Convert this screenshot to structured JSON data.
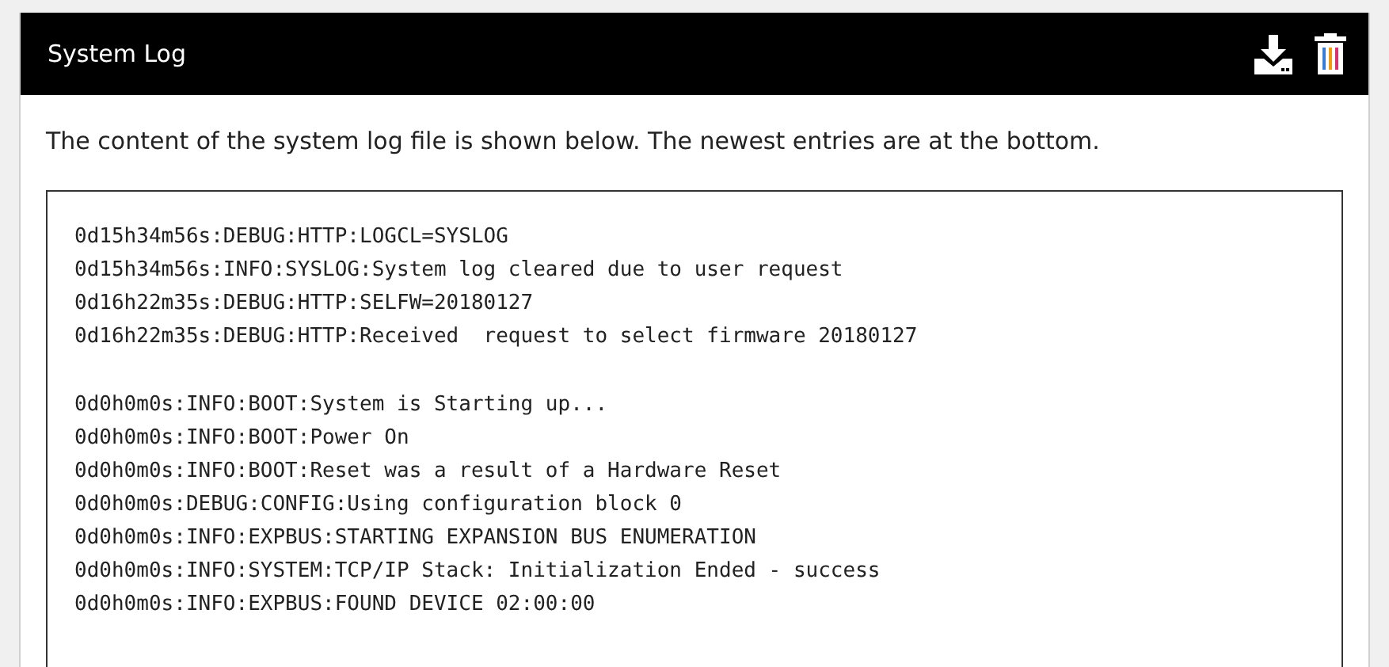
{
  "panel": {
    "title": "System Log"
  },
  "description": "The content of the system log file is shown below. The newest entries are at the bottom.",
  "log_blocks": [
    [
      "0d15h34m56s:DEBUG:HTTP:LOGCL=SYSLOG",
      "0d15h34m56s:INFO:SYSLOG:System log cleared due to user request",
      "0d16h22m35s:DEBUG:HTTP:SELFW=20180127",
      "0d16h22m35s:DEBUG:HTTP:Received  request to select firmware 20180127"
    ],
    [
      "0d0h0m0s:INFO:BOOT:System is Starting up...",
      "0d0h0m0s:INFO:BOOT:Power On",
      "0d0h0m0s:INFO:BOOT:Reset was a result of a Hardware Reset",
      "0d0h0m0s:DEBUG:CONFIG:Using configuration block 0",
      "0d0h0m0s:INFO:EXPBUS:STARTING EXPANSION BUS ENUMERATION",
      "0d0h0m0s:INFO:SYSTEM:TCP/IP Stack: Initialization Ended - success",
      "0d0h0m0s:INFO:EXPBUS:FOUND DEVICE 02:00:00"
    ]
  ]
}
